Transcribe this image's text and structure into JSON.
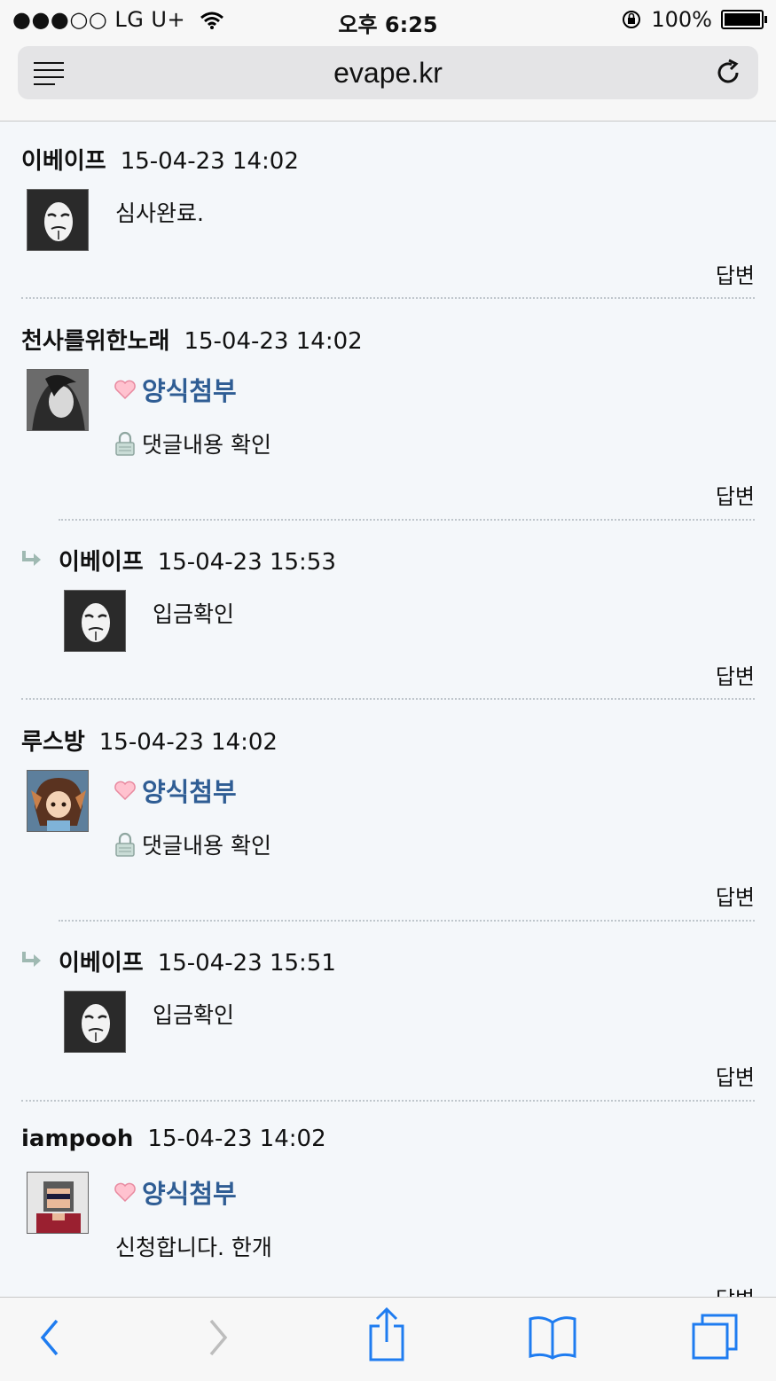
{
  "status_bar": {
    "carrier": "●●●○○ LG U+",
    "time": "오후 6:25",
    "battery": "100%"
  },
  "browser": {
    "url": "evape.kr"
  },
  "comments": [
    {
      "author": "이베이프",
      "date": "15-04-23 14:02",
      "text": "심사완료.",
      "reply": "답변"
    },
    {
      "author": "천사를위한노래",
      "date": "15-04-23 14:02",
      "form_title": "양식첨부",
      "secret_text": "댓글내용 확인",
      "reply": "답변"
    },
    {
      "author": "이베이프",
      "date": "15-04-23 15:53",
      "text": "입금확인",
      "reply": "답변"
    },
    {
      "author": "루스방",
      "date": "15-04-23 14:02",
      "form_title": "양식첨부",
      "secret_text": "댓글내용 확인",
      "reply": "답변"
    },
    {
      "author": "이베이프",
      "date": "15-04-23 15:51",
      "text": "입금확인",
      "reply": "답변"
    },
    {
      "author": "iampooh",
      "date": "15-04-23 14:02",
      "form_title": "양식첨부",
      "text": "신청합니다. 한개",
      "reply": "답변"
    }
  ],
  "icons": {
    "reader": "reader-icon",
    "reload": "reload-icon",
    "back": "back-icon",
    "forward": "forward-icon",
    "share": "share-icon",
    "bookmarks": "bookmarks-icon",
    "tabs": "tabs-icon",
    "heart": "heart-icon",
    "lock": "lock-icon",
    "reply_arrow": "reply-arrow-icon"
  },
  "colors": {
    "accent": "#2f5d94",
    "toolbar_blue": "#1f7cf0"
  }
}
